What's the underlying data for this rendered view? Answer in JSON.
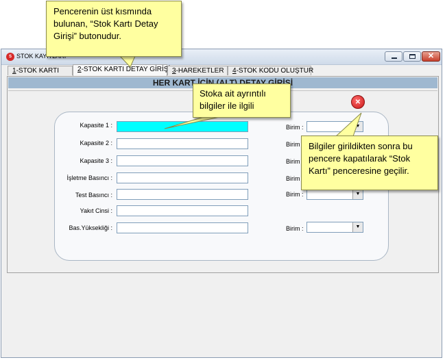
{
  "window": {
    "title": "STOK KAYITLARI",
    "icon_name": "app-logo-icon"
  },
  "tabs": [
    {
      "key": "1",
      "label": "-STOK KARTI",
      "active": false
    },
    {
      "key": "2",
      "label": "-STOK KARTI DETAY GİRİŞİ",
      "active": true
    },
    {
      "key": "3",
      "label": "-HAREKETLER",
      "active": false
    },
    {
      "key": "4",
      "label": "-STOK KODU OLUŞTUR",
      "active": false
    }
  ],
  "panel": {
    "header": "HER KART İÇİN (ALT) DETAY GİRİŞİ"
  },
  "form": {
    "fields": [
      {
        "label": "Kapasite 1 :",
        "value": "",
        "has_birim": true
      },
      {
        "label": "Kapasite 2 :",
        "value": "",
        "has_birim": true
      },
      {
        "label": "Kapasite 3 :",
        "value": "",
        "has_birim": true
      },
      {
        "label": "İşletme Basıncı :",
        "value": "",
        "has_birim": true
      },
      {
        "label": "Test Basıncı :",
        "value": "",
        "has_birim": true
      },
      {
        "label": "Yakıt Cinsi :",
        "value": "",
        "has_birim": false
      },
      {
        "label": "Bas.Yüksekliği :",
        "value": "",
        "has_birim": true
      }
    ],
    "birim_label": "Birim :",
    "birim_selected": ""
  },
  "callouts": {
    "top": "Pencerenin üst kısmında bulunan, “Stok Kartı Detay Girişi” butonudur.",
    "middle": "Stoka ait ayrıntılı bilgiler ile ilgili",
    "right": "Bilgiler girildikten sonra bu pencere kapatılarak “Stok Kartı” penceresine geçilir."
  },
  "colors": {
    "active_input": "#00ffff",
    "callout_bg": "#ffffa0",
    "panel_header_bg": "#9fb8d0"
  }
}
